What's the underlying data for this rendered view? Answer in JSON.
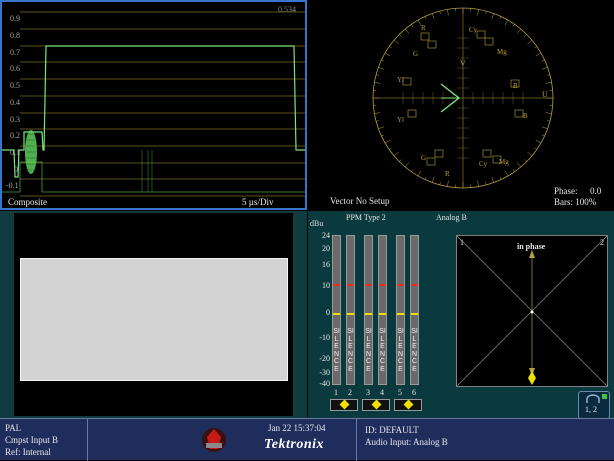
{
  "waveform": {
    "readout": "0.534",
    "scale_labels": [
      "0.9",
      "0.8",
      "0.7",
      "0.6",
      "0.5",
      "0.4",
      "0.3",
      "0.2",
      "0.1",
      "0",
      "-0.1"
    ],
    "mode_label": "Composite",
    "timebase_label": "5 µs/Div"
  },
  "vector": {
    "setup_label": "Vector No Setup",
    "phase_label": "Phase:",
    "phase_value": "0.0",
    "bars_label": "Bars: 100%",
    "axis_labels": {
      "v": "V",
      "u": "U"
    },
    "target_labels": [
      "R",
      "Mg",
      "Yl",
      "B",
      "G",
      "Cy",
      "Yl",
      "Cy",
      "G",
      "R",
      "Mg",
      "B"
    ]
  },
  "picture": {},
  "audio": {
    "dbu_label": "dBu",
    "ppm_label": "PPM Type 2",
    "input_label": "Analog B",
    "scale": [
      "24",
      "20",
      "16",
      "10",
      "0",
      "-10",
      "-20",
      "-30",
      "-40"
    ],
    "meter_text": "SILENCE",
    "channels": [
      "1",
      "2",
      "3",
      "4",
      "5",
      "6"
    ],
    "lissajous_left": "1",
    "lissajous_right": "2",
    "phase_text": "in phase",
    "speaker_channels": "1, 2"
  },
  "status": {
    "standard": "PAL",
    "input": "Cmpst Input B",
    "ref": "Ref: Internal",
    "datetime": "Jan 22 15:37:04",
    "brand": "Tektronix",
    "id": "ID: DEFAULT",
    "audio_input": "Audio Input: Analog B"
  },
  "colors": {
    "trace": "#7de37d",
    "graticule": "#b8a03a",
    "panel_border": "#3a76c8",
    "status_bg": "#1f2d5c",
    "audio_bg": "#0a3a3e",
    "marker_yellow": "#f0e000",
    "peak_red": "#e03030"
  }
}
